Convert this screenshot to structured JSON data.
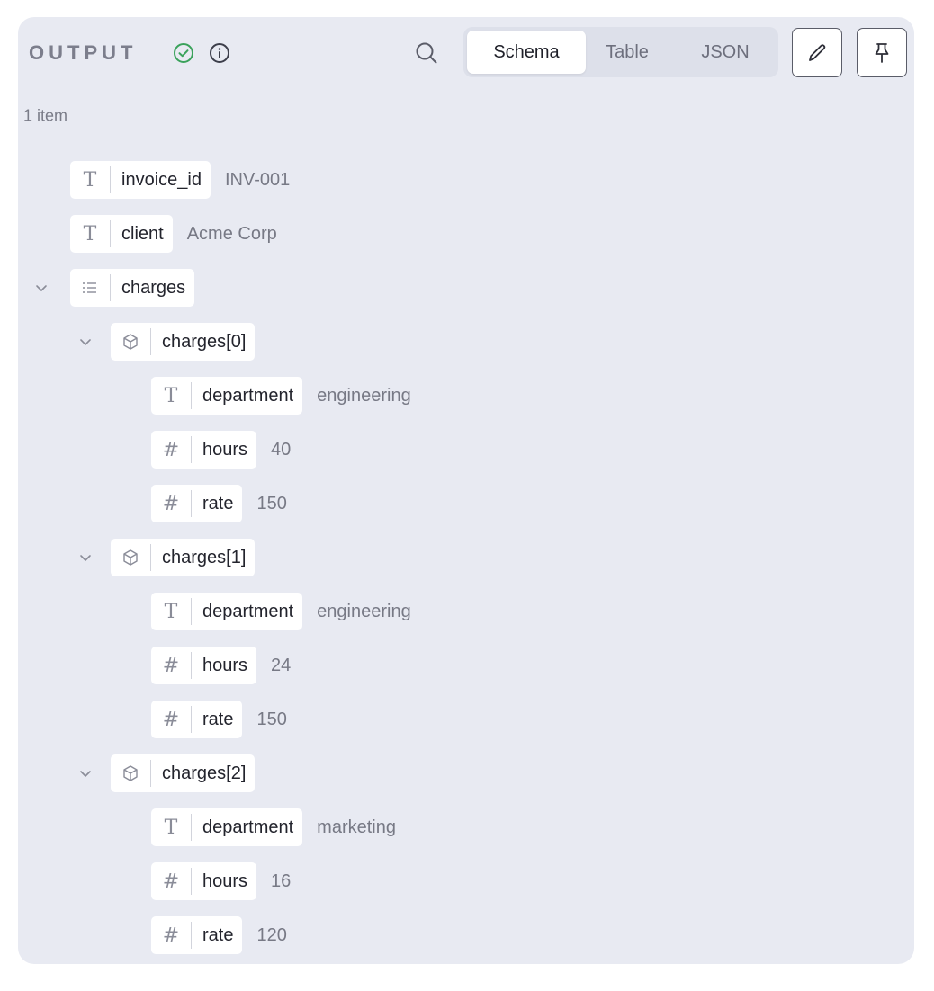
{
  "header": {
    "title": "OUTPUT",
    "success_icon": "check-circle-icon",
    "info_icon": "info-icon",
    "search_icon": "search-icon",
    "tabs": [
      {
        "label": "Schema",
        "active": true
      },
      {
        "label": "Table",
        "active": false
      },
      {
        "label": "JSON",
        "active": false
      }
    ],
    "edit_icon": "pencil-icon",
    "pin_icon": "pin-icon"
  },
  "summary": {
    "count": "1 item"
  },
  "colors": {
    "panel": "#e8eaf2",
    "success": "#3aa25b",
    "text": "#23242d",
    "muted": "#777985"
  },
  "tree": {
    "invoice_id": {
      "type": "string",
      "key": "invoice_id",
      "value": "INV-001"
    },
    "client": {
      "type": "string",
      "key": "client",
      "value": "Acme Corp"
    },
    "charges": {
      "type": "array",
      "key": "charges",
      "items": [
        {
          "key": "charges[0]",
          "department": "engineering",
          "hours": "40",
          "rate": "150"
        },
        {
          "key": "charges[1]",
          "department": "engineering",
          "hours": "24",
          "rate": "150"
        },
        {
          "key": "charges[2]",
          "department": "marketing",
          "hours": "16",
          "rate": "120"
        }
      ],
      "field_keys": {
        "department": "department",
        "hours": "hours",
        "rate": "rate"
      }
    }
  }
}
